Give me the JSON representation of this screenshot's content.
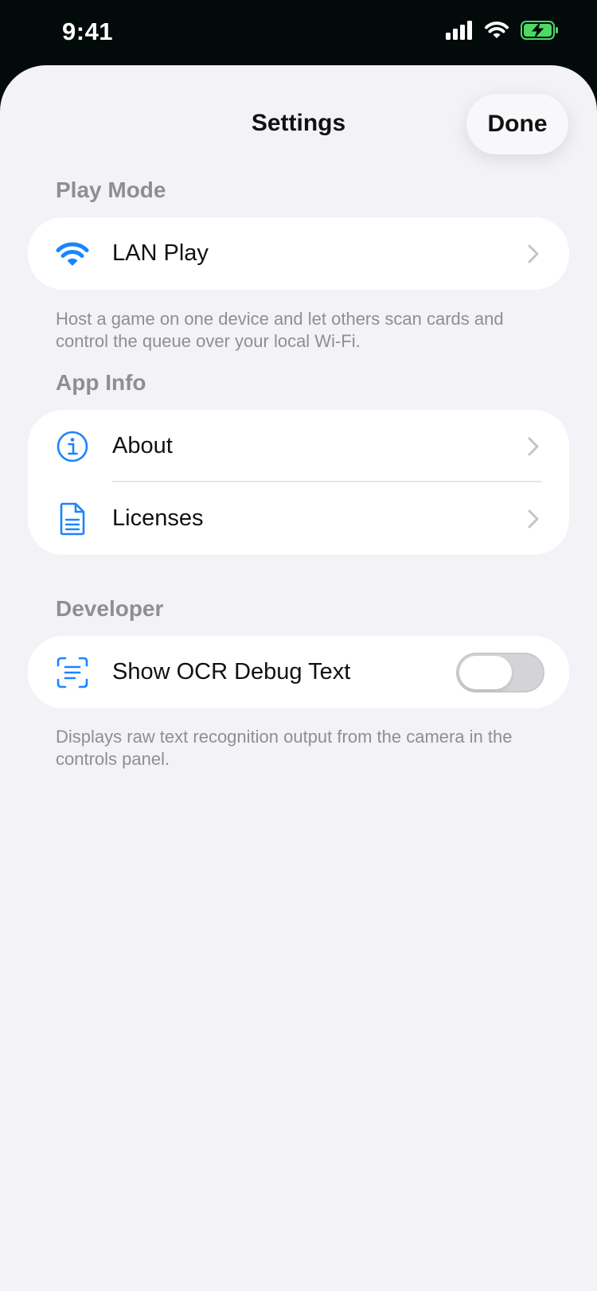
{
  "status_bar": {
    "time": "9:41",
    "icons": [
      "cellular-signal-icon",
      "wifi-icon",
      "battery-charging-icon"
    ]
  },
  "nav": {
    "title": "Settings",
    "done_label": "Done"
  },
  "sections": {
    "play_mode": {
      "header": "Play Mode",
      "rows": [
        {
          "label": "LAN Play",
          "icon": "wifi-icon"
        }
      ],
      "footer": "Host a game on one device and let others scan cards and control the queue over your local Wi-Fi."
    },
    "app_info": {
      "header": "App Info",
      "rows": [
        {
          "label": "About",
          "icon": "info-circle-icon"
        },
        {
          "label": "Licenses",
          "icon": "document-icon"
        }
      ]
    },
    "developer": {
      "header": "Developer",
      "rows": [
        {
          "label": "Show OCR Debug Text",
          "icon": "text-scan-icon",
          "toggle_on": false
        }
      ],
      "footer": "Displays raw text recognition output from the camera in the controls panel."
    }
  },
  "colors": {
    "accent": "#1a84ff",
    "background": "#f2f2f7",
    "secondary_text": "#8e8e93"
  }
}
